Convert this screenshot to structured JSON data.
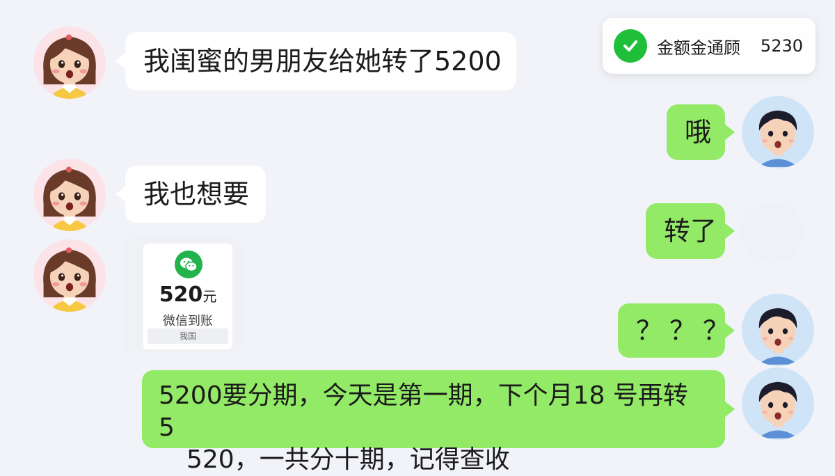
{
  "toast": {
    "icon": "check-circle-icon",
    "label": "金额金通顾",
    "amount": "5230"
  },
  "messages": [
    {
      "side": "left",
      "sender": "girl",
      "text": "我闺蜜的男朋友给她转了5200"
    },
    {
      "side": "right",
      "sender": "boy",
      "text": "哦"
    },
    {
      "side": "left",
      "sender": "girl",
      "text": "我也想要"
    },
    {
      "side": "right",
      "sender": "boy",
      "text": "转了"
    },
    {
      "side": "left",
      "sender": "girl",
      "type": "transfer-card",
      "card": {
        "icon": "wechat-icon",
        "amount": "520",
        "currency": "元",
        "status": "微信到账",
        "footer": "我国"
      }
    },
    {
      "side": "right",
      "sender": "boy",
      "text": "？？？"
    },
    {
      "side": "right",
      "sender": "boy",
      "lines": [
        "5200要分期，今天是第一期，下个月18 号再转 5",
        "520，一共分十期，记得查收"
      ]
    }
  ],
  "colors": {
    "background": "#f1f3f9",
    "incoming_bubble": "#ffffff",
    "outgoing_bubble": "#93ea67",
    "check": "#1fbf3a",
    "wechat": "#22b34a"
  }
}
